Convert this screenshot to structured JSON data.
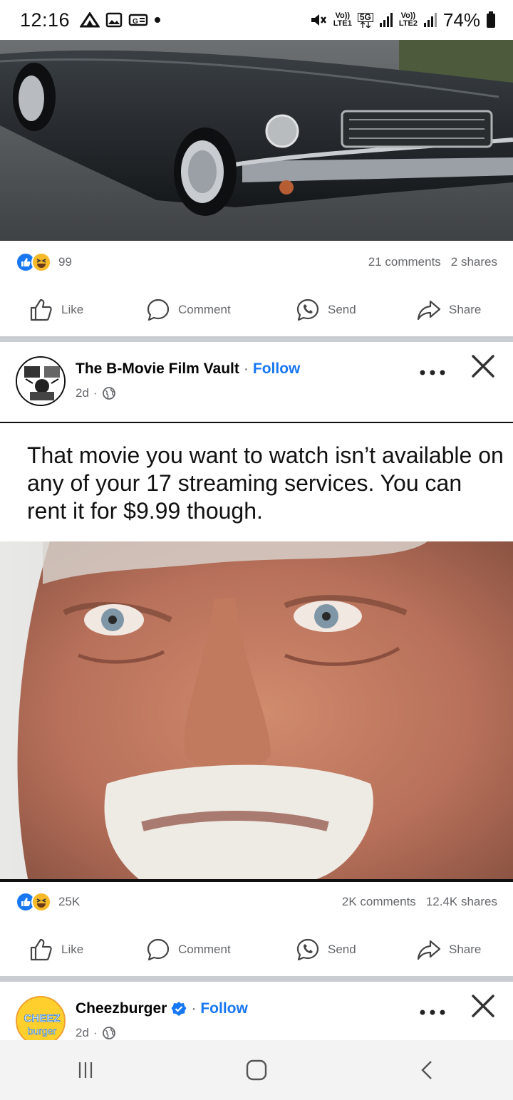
{
  "status_bar": {
    "time": "12:16",
    "battery": "74%",
    "net1_top": "Vo))",
    "net1_bottom": "LTE1",
    "net2_top": "Vo))",
    "net2_bottom": "LTE2",
    "net_5g": "5G"
  },
  "post1": {
    "reaction_count": "99",
    "comments": "21 comments",
    "shares": "2 shares"
  },
  "actions": {
    "like": "Like",
    "comment": "Comment",
    "send": "Send",
    "share": "Share"
  },
  "post2": {
    "page_name": "The B-Movie Film Vault",
    "follow": "Follow",
    "time": "2d",
    "meme_text": "That movie you want to watch isn’t available on any of your 17 streaming services. You can rent it for $9.99 though.",
    "reaction_count": "25K",
    "comments": "2K comments",
    "shares": "12.4K shares"
  },
  "post3": {
    "page_name": "Cheezburger",
    "follow": "Follow",
    "time": "2d",
    "avatar_text_top": "CHEEZ",
    "avatar_text_bottom": "burger"
  },
  "separators": {
    "dot": "·"
  },
  "icons": {
    "like": "thumbs-up-icon",
    "comment": "speech-bubble-icon",
    "send": "messenger-icon",
    "share": "share-arrow-icon",
    "globe": "globe-icon",
    "verified": "verified-badge-icon"
  },
  "colors": {
    "accent": "#1877f2",
    "secondary_text": "#65676b",
    "divider": "#c9ccd1"
  }
}
